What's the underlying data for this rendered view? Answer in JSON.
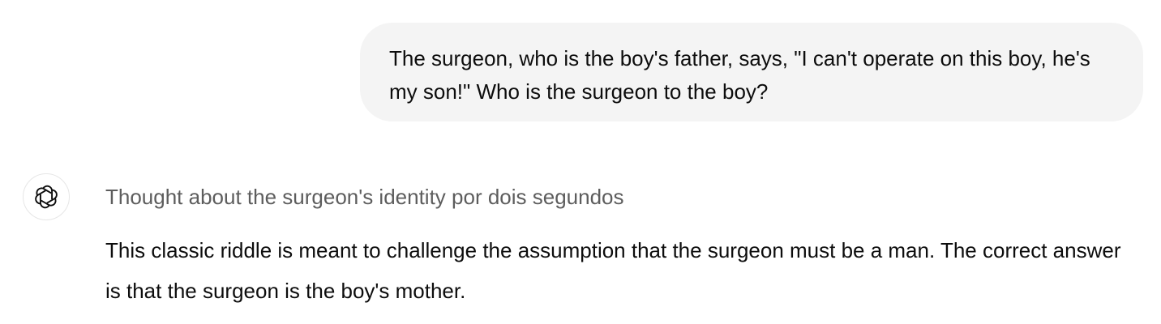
{
  "conversation": {
    "user_message": "The surgeon, who is the boy's father, says, \"I can't operate on this boy, he's my son!\" Who is the surgeon to the boy?",
    "assistant": {
      "avatar_icon": "openai-logo-icon",
      "thought_summary": "Thought about the surgeon's identity por dois segundos",
      "response": "This classic riddle is meant to challenge the assumption that the surgeon must be a man. The correct answer is that the surgeon is the boy's mother."
    }
  },
  "colors": {
    "user_bubble_bg": "#f4f4f4",
    "text_primary": "#0d0d0d",
    "text_secondary": "#5d5d5d",
    "avatar_border": "#e6e6e6"
  }
}
